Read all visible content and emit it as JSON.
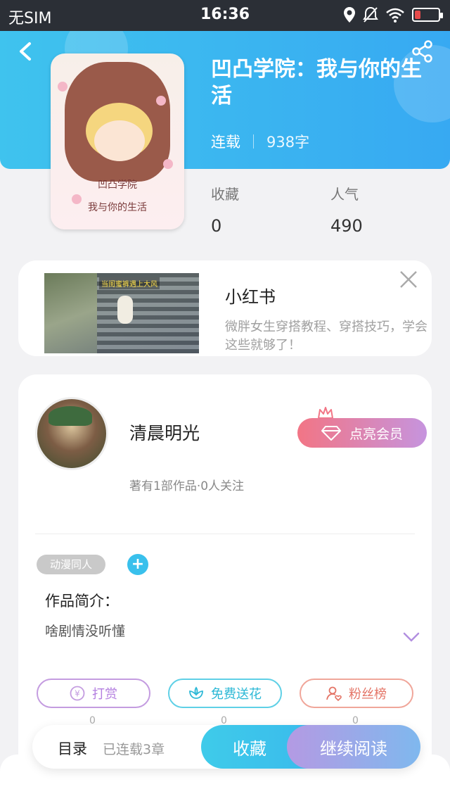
{
  "status_bar": {
    "carrier": "无SIM",
    "time": "16:36",
    "battery_level": 0.25,
    "icons": [
      "location-icon",
      "mute-icon",
      "wifi-icon",
      "battery-icon"
    ]
  },
  "header": {
    "title": "凹凸学院：我与你的生活",
    "status": "连载",
    "word_count": "938字",
    "stats": [
      {
        "label": "收藏",
        "value": "0"
      },
      {
        "label": "人气",
        "value": "490"
      }
    ],
    "cover_text_line1": "凹凸学院",
    "cover_text_line2": "我与你的生活"
  },
  "ad": {
    "thumb_caption": "当闺蜜裤遇上大风",
    "title": "小红书",
    "description": "微胖女生穿搭教程、穿搭技巧，学会这些就够了！"
  },
  "author": {
    "name": "清晨明光",
    "info": "著有1部作品·0人关注",
    "vip_label": "点亮会员"
  },
  "work": {
    "tag": "动漫同人",
    "add_tag": "+",
    "intro_label": "作品简介：",
    "intro_text": "啥剧情没听懂"
  },
  "actions": [
    {
      "label": "打赏",
      "count": "0",
      "icon": "yen-icon"
    },
    {
      "label": "免费送花",
      "count": "0",
      "icon": "flower-icon"
    },
    {
      "label": "粉丝榜",
      "count": "0",
      "icon": "fan-icon"
    }
  ],
  "bottom_bar": {
    "toc": "目录",
    "serial": "已连载3章",
    "collect": "收藏",
    "read": "继续阅读"
  },
  "colors": {
    "header_blue": "#37a9f2",
    "accent_cyan": "#39c0ec",
    "vip_pink": "#f27585",
    "vip_purple": "#c694de"
  }
}
